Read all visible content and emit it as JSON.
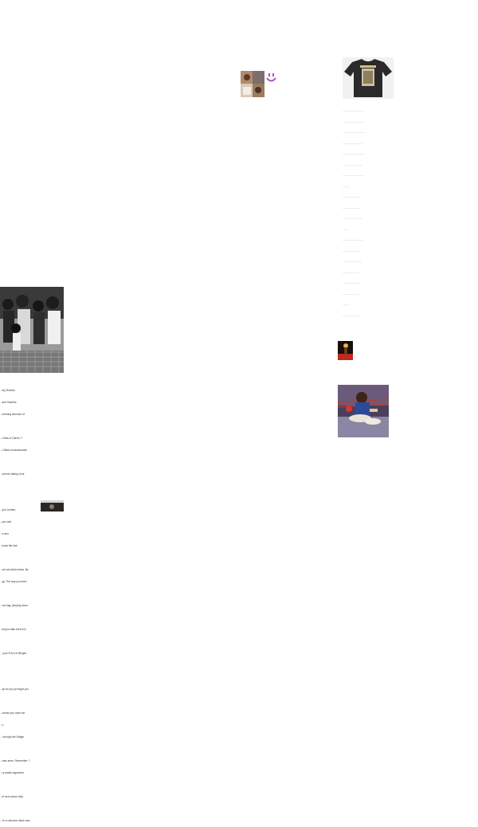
{
  "page": {
    "background": "#ffffff",
    "accent_color": "#a352c9"
  },
  "images": {
    "collage_thumb": {
      "icon": "photo-collage",
      "caption": ""
    },
    "tshirt_photo": {
      "icon": "black-t-shirt-photo",
      "caption": ""
    },
    "protest_photo": {
      "icon": "black-and-white-crowd-photo",
      "caption": ""
    },
    "concert_photo": {
      "icon": "red-stage-photo",
      "caption": ""
    },
    "boxing_photo": {
      "icon": "boxer-in-ring-photo",
      "caption": ""
    },
    "corner_photo": {
      "icon": "dark-photo",
      "caption": ""
    }
  },
  "smiley": {
    "icon": "smiley-face-icon",
    "color": "#a352c9"
  },
  "shirt_notes": {
    "lines": [
      "................................",
      "...............................",
      "..................................",
      "..............................",
      ".................................",
      "..............................",
      "................................",
      "...........",
      "............................",
      "...........................",
      "..............................",
      ".......",
      "...............................",
      "..........................",
      ".............................",
      ".........................",
      "............................",
      ".........................",
      "..........",
      "..........................."
    ]
  },
  "lyrics": {
    "lines": [
      "...ely, Brother,",
      "...and Sashthe.",
      "...verthing structure of",
      "",
      "...t Was or Garvin ?\"",
      "...r Black revolutionaries",
      "",
      "...ommer talking 'bout",
      "",
      "",
      "...yell, brother,",
      "...pun and",
      "...s who",
      "...looks like fork",
      "",
      "...ont act kinda mixas. By",
      "...gy. The way you been",
      "",
      "...ool-bag, jumping down.",
      "",
      "...they're after their B.A.",
      "",
      "... your B.A is in Bergen.",
      "",
      "",
      "...ay for you ya forgot you",
      "",
      "...owned you have the",
      "...s",
      "... through the Village",
      "",
      "...rank arms. Remember ?",
      "...ry banks organized.",
      "",
      "...le form where hefy",
      "",
      "...'re a ransome black man."
    ]
  }
}
